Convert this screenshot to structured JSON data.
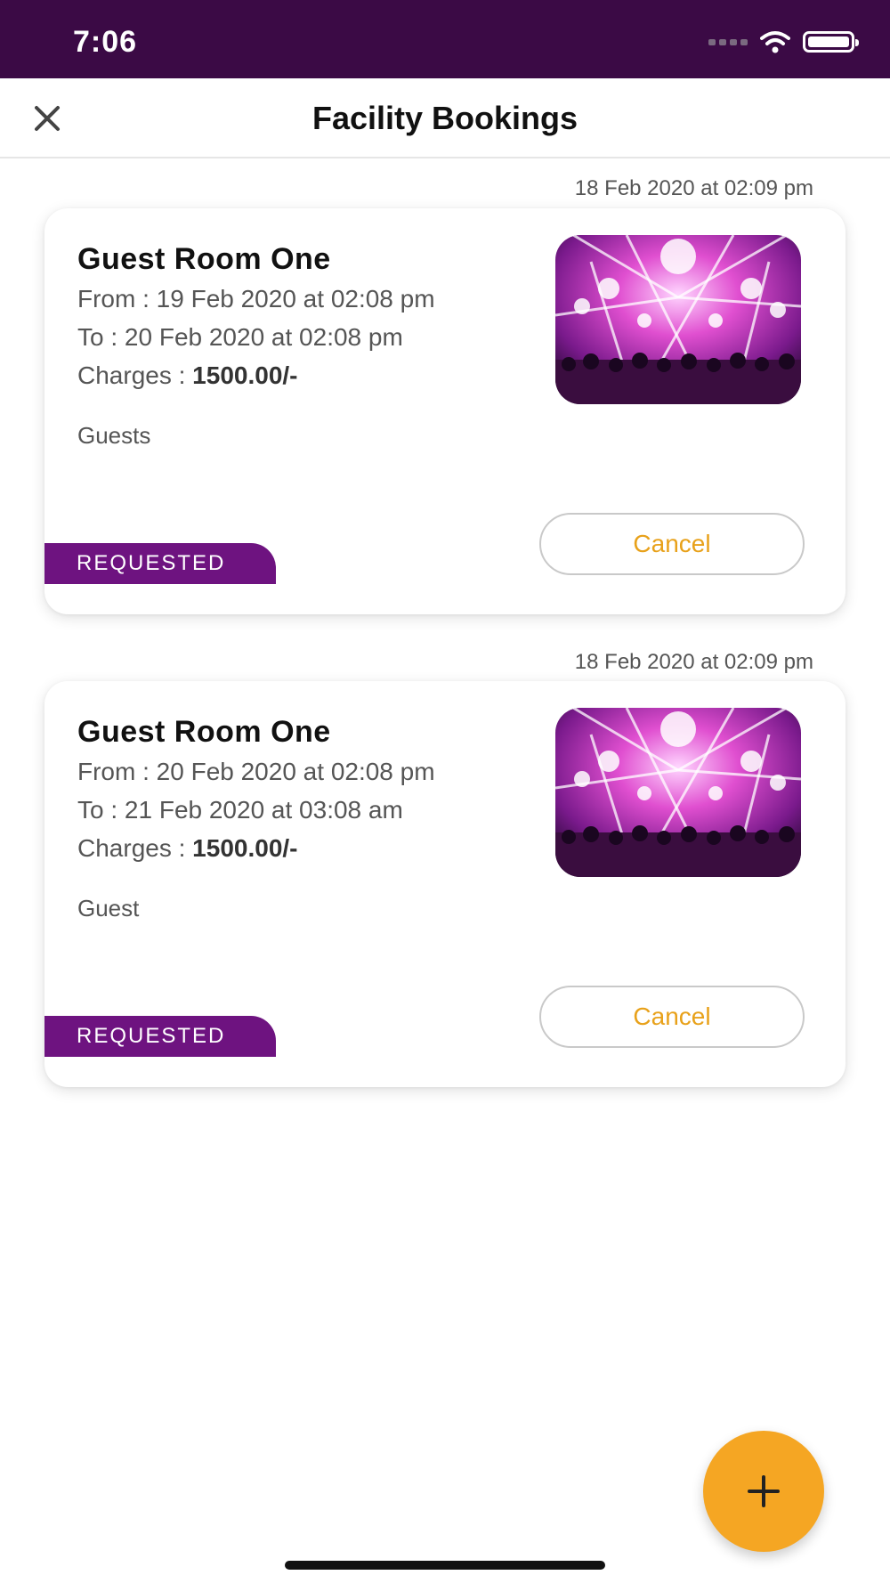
{
  "status_bar": {
    "time": "7:06"
  },
  "header": {
    "title": "Facility Bookings"
  },
  "bookings": [
    {
      "created": "18 Feb 2020 at 02:09 pm",
      "title": "Guest Room One",
      "from": "From : 19 Feb 2020 at 02:08 pm",
      "to": "To : 20 Feb 2020 at 02:08 pm",
      "charges_label": "Charges : ",
      "charges_value": "1500.00/-",
      "note": "Guests",
      "cancel_label": "Cancel",
      "status": "REQUESTED"
    },
    {
      "created": "18 Feb 2020 at 02:09 pm",
      "title": "Guest Room One",
      "from": "From : 20 Feb 2020 at 02:08 pm",
      "to": "To : 21 Feb 2020 at 03:08 am",
      "charges_label": "Charges : ",
      "charges_value": "1500.00/-",
      "note": "Guest",
      "cancel_label": "Cancel",
      "status": "REQUESTED"
    }
  ],
  "fab": {
    "icon": "plus-icon"
  },
  "colors": {
    "status_bar": "#3b0a45",
    "badge": "#6e1380",
    "accent": "#f5a623",
    "cancel_text": "#e8a11a"
  }
}
